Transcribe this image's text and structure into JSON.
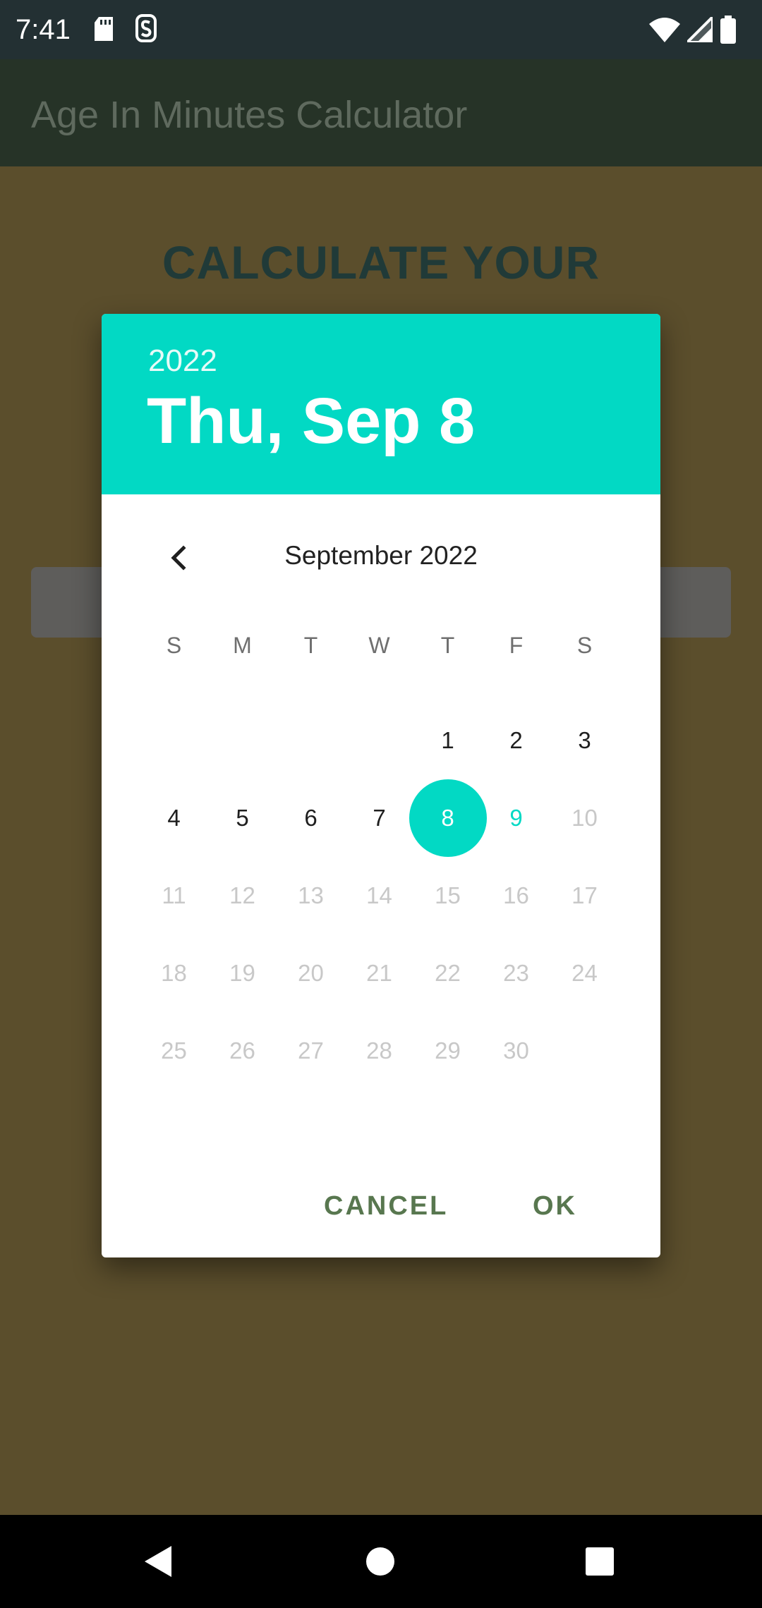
{
  "status_bar": {
    "time": "7:41"
  },
  "app_bar": {
    "title": "Age In Minutes Calculator"
  },
  "content": {
    "headline": "CALCULATE YOUR"
  },
  "dialog": {
    "year": "2022",
    "selected_date": "Thu, Sep 8",
    "month_label": "September 2022",
    "weekdays": [
      "S",
      "M",
      "T",
      "W",
      "T",
      "F",
      "S"
    ],
    "weeks": [
      [
        "",
        "",
        "",
        "",
        "1",
        "2",
        "3"
      ],
      [
        "4",
        "5",
        "6",
        "7",
        "8",
        "9",
        "10"
      ],
      [
        "11",
        "12",
        "13",
        "14",
        "15",
        "16",
        "17"
      ],
      [
        "18",
        "19",
        "20",
        "21",
        "22",
        "23",
        "24"
      ],
      [
        "25",
        "26",
        "27",
        "28",
        "29",
        "30",
        ""
      ]
    ],
    "selected_day": "8",
    "today_day": "9",
    "cancel_label": "CANCEL",
    "ok_label": "OK"
  },
  "colors": {
    "accent": "#02d9c4",
    "button_text": "#58774f",
    "scrim_background": "#5b4e2c"
  },
  "icons": {
    "prev_month": "chevron-left-icon",
    "status": [
      "sd-card-icon",
      "s-notification-icon",
      "wifi-icon",
      "signal-icon",
      "battery-icon"
    ],
    "nav": [
      "back-icon",
      "home-icon",
      "recents-icon"
    ]
  }
}
